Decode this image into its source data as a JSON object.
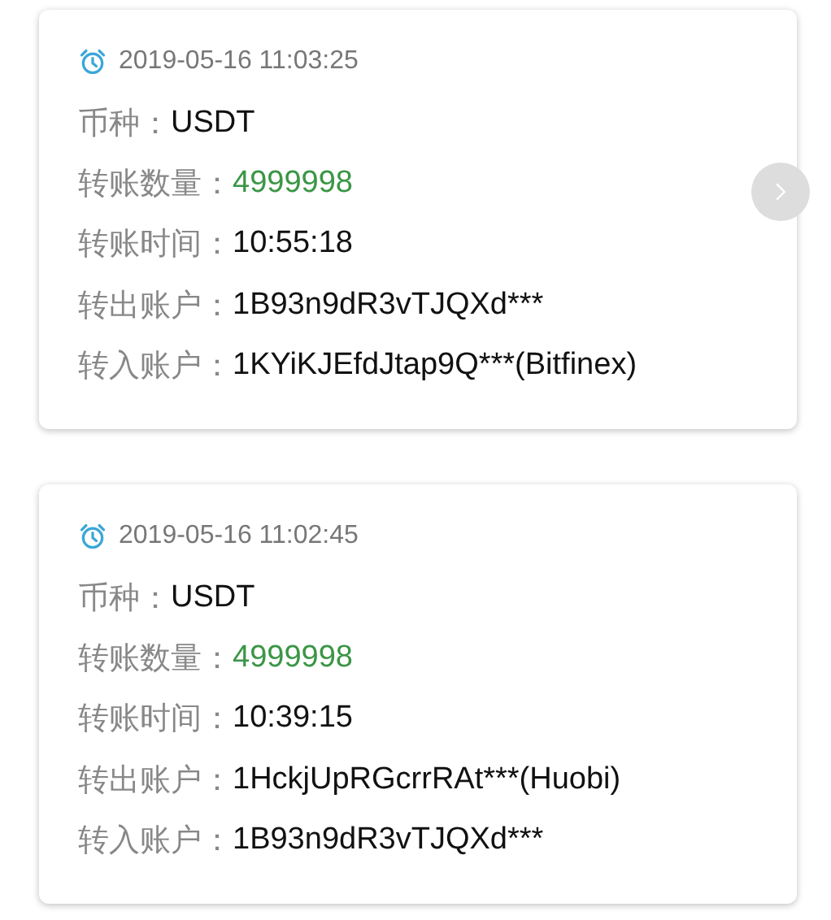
{
  "records": [
    {
      "timestamp": "2019-05-16 11:03:25",
      "fields": [
        {
          "label": "币种：",
          "value": "USDT",
          "kind": "text"
        },
        {
          "label": "转账数量：",
          "value": "4999998",
          "kind": "amount"
        },
        {
          "label": "转账时间：",
          "value": "10:55:18",
          "kind": "text"
        },
        {
          "label": "转出账户：",
          "value": "1B93n9dR3vTJQXd***",
          "kind": "text"
        },
        {
          "label": "转入账户：",
          "value": "1KYiKJEfdJtap9Q***(Bitfinex)",
          "kind": "text"
        }
      ]
    },
    {
      "timestamp": "2019-05-16 11:02:45",
      "fields": [
        {
          "label": "币种：",
          "value": "USDT",
          "kind": "text"
        },
        {
          "label": "转账数量：",
          "value": "4999998",
          "kind": "amount"
        },
        {
          "label": "转账时间：",
          "value": "10:39:15",
          "kind": "text"
        },
        {
          "label": "转出账户：",
          "value": "1HckjUpRGcrrRAt***(Huobi)",
          "kind": "text"
        },
        {
          "label": "转入账户：",
          "value": "1B93n9dR3vTJQXd***",
          "kind": "text"
        }
      ]
    }
  ],
  "next_button": {
    "disabled": true
  }
}
